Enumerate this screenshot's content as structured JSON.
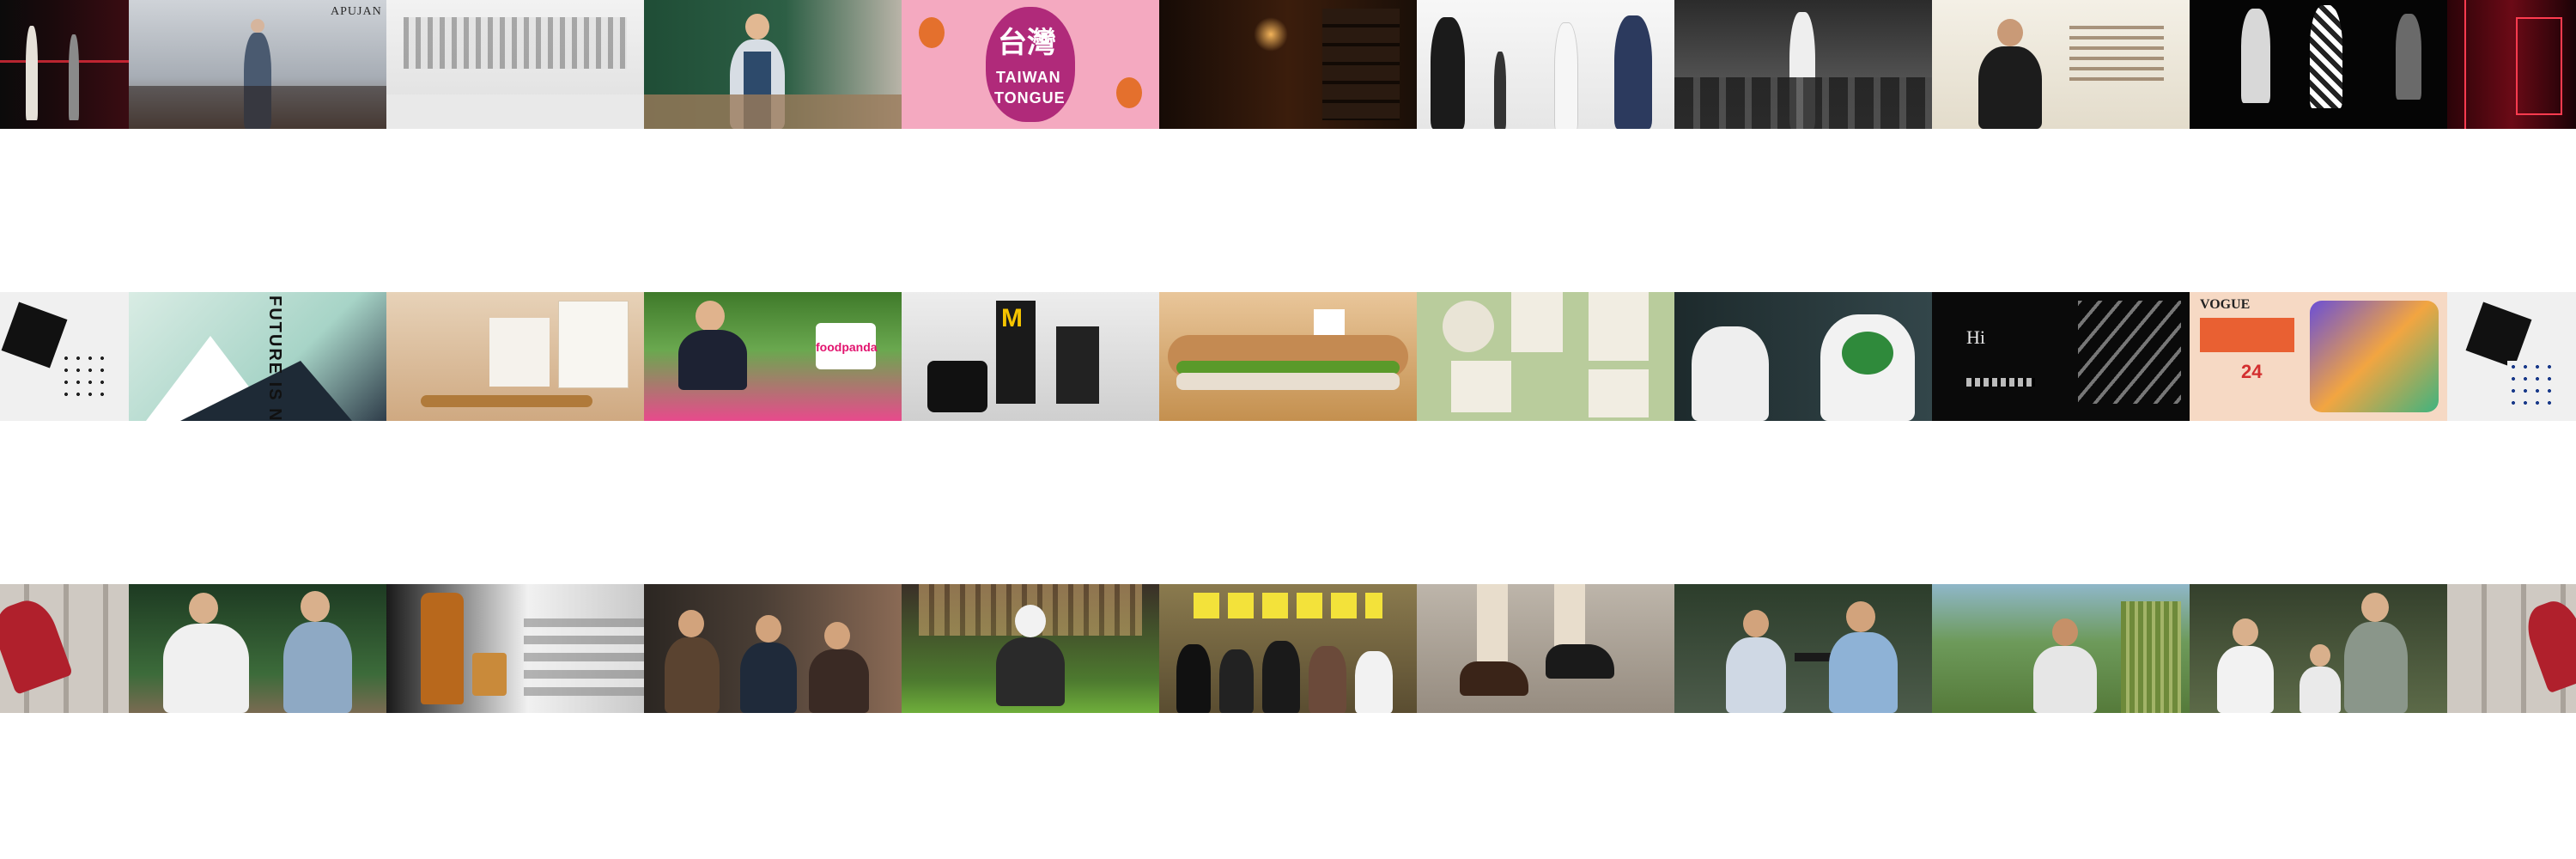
{
  "strips": [
    {
      "tiles": [
        {
          "name": "runway-red-laser"
        },
        {
          "name": "runway-model-dress",
          "caption": "APUJAN"
        },
        {
          "name": "white-showroom"
        },
        {
          "name": "chef-kitchen"
        },
        {
          "name": "taiwan-tongue-poster",
          "caption_cjk": "台灣",
          "caption_line1": "TAIWAN",
          "caption_line2": "TONGUE"
        },
        {
          "name": "dim-bar-interior"
        },
        {
          "name": "runway-white-backdrop"
        },
        {
          "name": "runway-audience"
        },
        {
          "name": "speaker-banner"
        },
        {
          "name": "mannequins-dark"
        },
        {
          "name": "red-laser-room"
        }
      ]
    },
    {
      "tiles": [
        {
          "name": "black-white-prints"
        },
        {
          "name": "future-is-now-artwork",
          "caption": "FUTURE IS NOW"
        },
        {
          "name": "gift-bag-still-life"
        },
        {
          "name": "foodpanda-picnic",
          "caption": "foodpanda"
        },
        {
          "name": "mcdonalds-meal-set"
        },
        {
          "name": "sandwich-closeup"
        },
        {
          "name": "bento-boxes"
        },
        {
          "name": "boys-tshirt-print"
        },
        {
          "name": "calligraphy-poster",
          "caption": "Hi"
        },
        {
          "name": "vogue-picnic-poster",
          "caption": "VOGUE",
          "caption_sub": "24"
        },
        {
          "name": "black-white-prints-edge"
        }
      ]
    },
    {
      "tiles": [
        {
          "name": "cinema-seat-sitter"
        },
        {
          "name": "garden-duo"
        },
        {
          "name": "whisky-bottle-still"
        },
        {
          "name": "cafe-trio"
        },
        {
          "name": "gamer-on-lawn"
        },
        {
          "name": "band-group-photo"
        },
        {
          "name": "shoe-lacing-closeup"
        },
        {
          "name": "patio-friends"
        },
        {
          "name": "field-farmer"
        },
        {
          "name": "family-portrait"
        },
        {
          "name": "cinema-seat-sitter-edge"
        }
      ]
    }
  ]
}
